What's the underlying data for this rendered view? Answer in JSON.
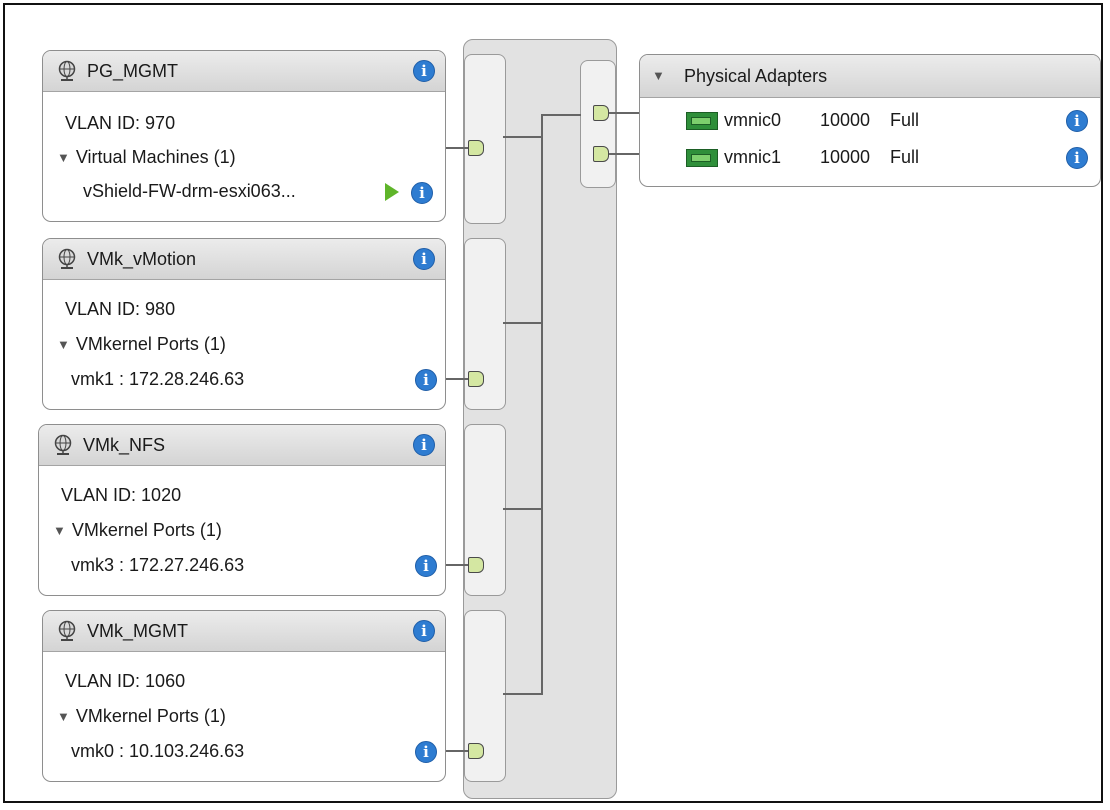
{
  "port_groups": [
    {
      "name": "PG_MGMT",
      "vlan_label": "VLAN ID:",
      "vlan_id": "970",
      "section": "Virtual Machines (1)",
      "member": "vShield-FW-drm-esxi063...",
      "member_powered_on": true
    },
    {
      "name": "VMk_vMotion",
      "vlan_label": "VLAN ID:",
      "vlan_id": "980",
      "section": "VMkernel Ports (1)",
      "member": "vmk1 : 172.28.246.63"
    },
    {
      "name": "VMk_NFS",
      "vlan_label": "VLAN ID:",
      "vlan_id": "1020",
      "section": "VMkernel Ports (1)",
      "member": "vmk3 : 172.27.246.63"
    },
    {
      "name": "VMk_MGMT",
      "vlan_label": "VLAN ID:",
      "vlan_id": "1060",
      "section": "VMkernel Ports (1)",
      "member": "vmk0 : 10.103.246.63"
    }
  ],
  "physical_adapters": {
    "title": "Physical Adapters",
    "adapters": [
      {
        "name": "vmnic0",
        "speed": "10000",
        "duplex": "Full"
      },
      {
        "name": "vmnic1",
        "speed": "10000",
        "duplex": "Full"
      }
    ]
  },
  "icons": {
    "portgroup": "network-globe-icon",
    "info": "info-icon",
    "expand": "triangle-down-icon",
    "vm_state": "play-icon",
    "adapter": "nic-card-icon",
    "port": "port-connector-icon"
  },
  "colors": {
    "info_blue": "#2e7cd1",
    "port_green": "#d4e7a2",
    "nic_green": "#2f8f3a",
    "play_green": "#5fb52a"
  }
}
